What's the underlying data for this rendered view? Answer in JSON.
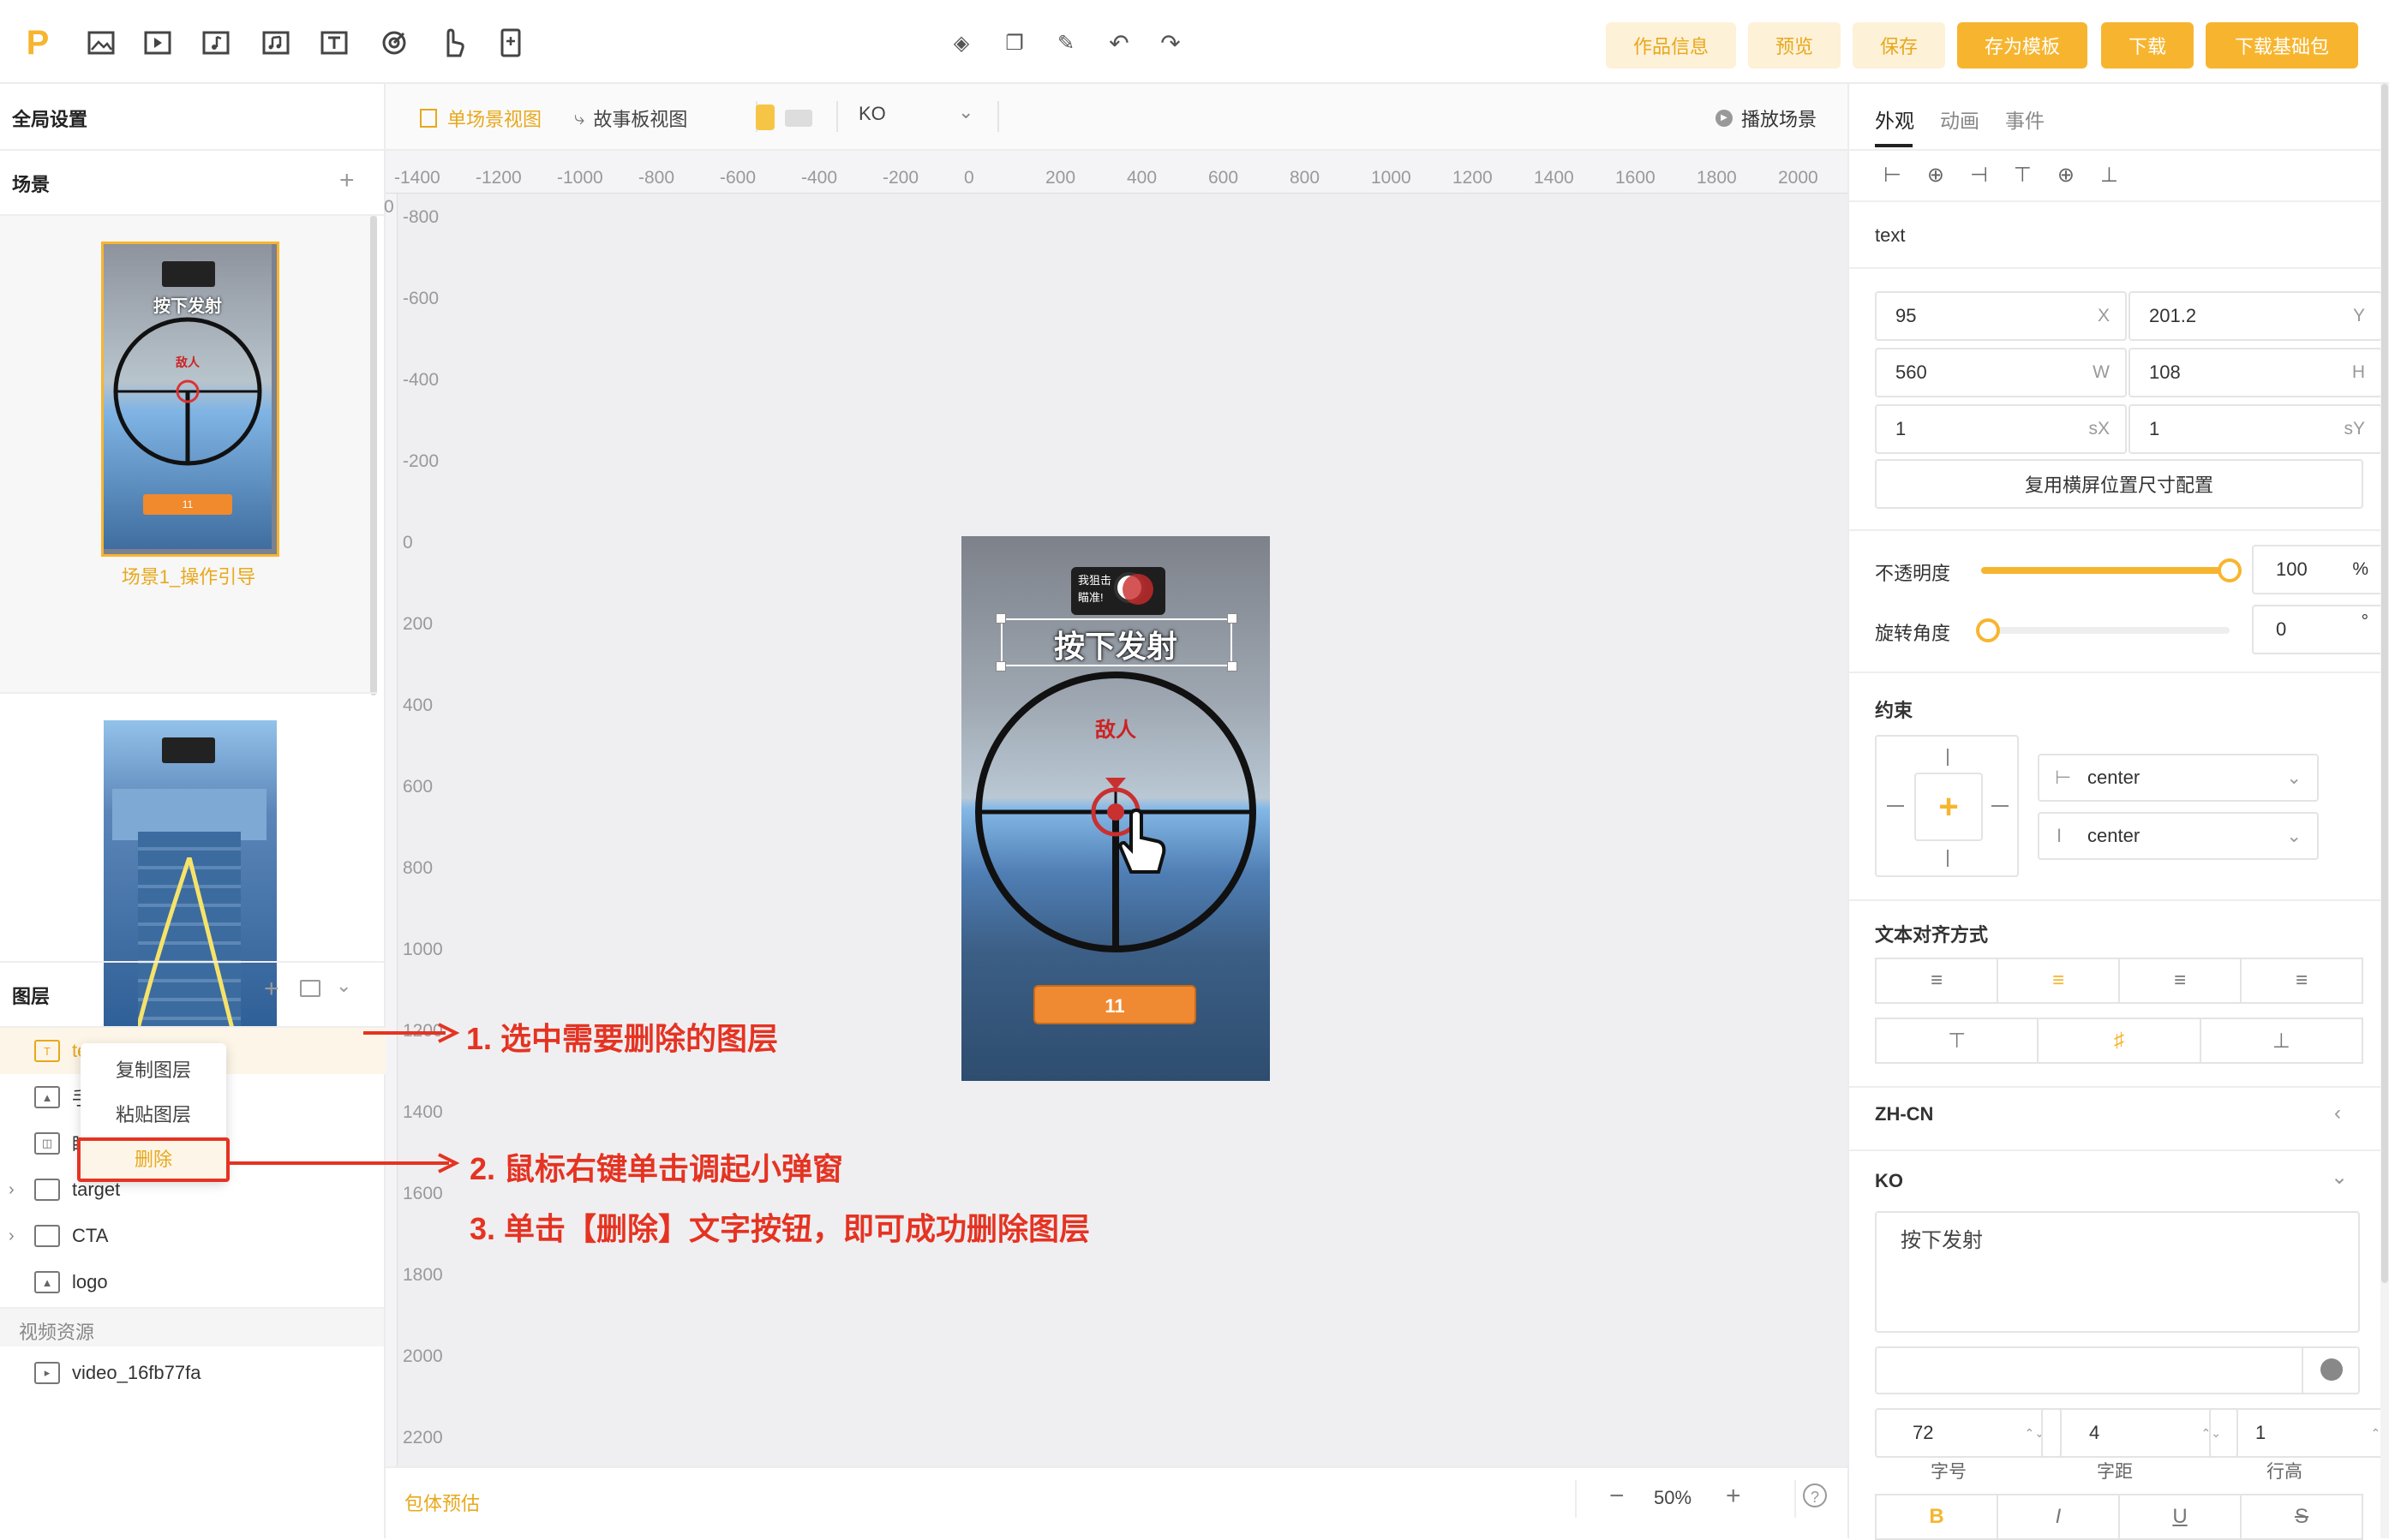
{
  "toolbar": {
    "tools": [
      "logo-icon",
      "image-icon",
      "video-icon",
      "audio-icon",
      "music-icon",
      "text-icon",
      "target-icon",
      "hand-icon",
      "phone-icon"
    ],
    "center_tools": [
      "layers-icon",
      "copy-icon",
      "tag-icon",
      "undo-icon",
      "redo-icon"
    ],
    "buttons": {
      "info": "作品信息",
      "preview": "预览",
      "save": "保存",
      "save_template": "存为模板",
      "download": "下载",
      "download_base": "下载基础包"
    }
  },
  "left": {
    "global_settings": "全局设置",
    "scene_title": "场景",
    "scene1_label": "场景1_操作引导",
    "scene_thumb1": {
      "banner": "按下发射",
      "enemy": "敌人",
      "button": "11"
    },
    "layers_title": "图层",
    "layers": [
      {
        "label": "text",
        "icon": "text-icon"
      },
      {
        "label": "手",
        "icon": "image-icon"
      },
      {
        "label": "瞄",
        "icon": "component-icon"
      },
      {
        "label": "target",
        "icon": "folder-icon"
      },
      {
        "label": "CTA",
        "icon": "folder-icon"
      },
      {
        "label": "logo",
        "icon": "image-icon"
      }
    ],
    "video_title": "视频资源",
    "video_item": "video_16fb77fa",
    "context_menu": {
      "copy": "复制图层",
      "paste": "粘贴图层",
      "delete": "删除"
    }
  },
  "canvas": {
    "view_single": "单场景视图",
    "view_storyboard": "故事板视图",
    "lang": "KO",
    "play": "播放场景",
    "ruler_x": [
      "-1400",
      "-1200",
      "-1000",
      "-800",
      "-600",
      "-400",
      "-200",
      "0",
      "200",
      "400",
      "600",
      "800",
      "1000",
      "1200",
      "1400",
      "1600",
      "1800",
      "2000"
    ],
    "ruler_y": [
      "0",
      "-800",
      "-600",
      "-400",
      "-200",
      "0",
      "200",
      "400",
      "600",
      "800",
      "1000",
      "1200",
      "1400",
      "1600",
      "1800",
      "2000",
      "2200"
    ],
    "stage": {
      "banner": "按下发射",
      "enemy": "敌人",
      "button": "11",
      "logo_text": "我狙击\n瞄准!"
    },
    "footer_left": "包体预估",
    "zoom": "50%",
    "zoom_minus": "−",
    "zoom_plus": "+",
    "help": "?"
  },
  "annotations": {
    "step1": "1. 选中需要删除的图层",
    "step2": "2. 鼠标右键单击调起小弹窗",
    "step3": "3. 单击【删除】文字按钮，即可成功删除图层"
  },
  "right": {
    "tabs": [
      "外观",
      "动画",
      "事件"
    ],
    "element_name": "text",
    "x": "95",
    "x_suf": "X",
    "y": "201.2",
    "y_suf": "Y",
    "w": "560",
    "w_suf": "W",
    "h": "108",
    "h_suf": "H",
    "sx": "1",
    "sx_suf": "sX",
    "sy": "1",
    "sy_suf": "sY",
    "reuse_btn": "复用横屏位置尺寸配置",
    "opacity_label": "不透明度",
    "opacity_value": "100",
    "opacity_unit": "%",
    "opacity_level": 1.0,
    "rotation_label": "旋转角度",
    "rotation_value": "0",
    "rotation_unit": "°",
    "constraint_title": "约束",
    "constraint_h": "center",
    "constraint_v": "center",
    "text_align_title": "文本对齐方式",
    "lang_zh": "ZH-CN",
    "lang_ko": "KO",
    "text_value": "按下发射",
    "font_size": "72",
    "font_size_label": "字号",
    "letter_spacing": "4",
    "letter_spacing_label": "字距",
    "line_height": "1",
    "line_height_label": "行高",
    "styles": [
      "B",
      "I",
      "U",
      "S"
    ]
  },
  "colors": {
    "accent": "#f7b52f",
    "annotation": "#e53322",
    "text_orange": "#e8a81c"
  }
}
